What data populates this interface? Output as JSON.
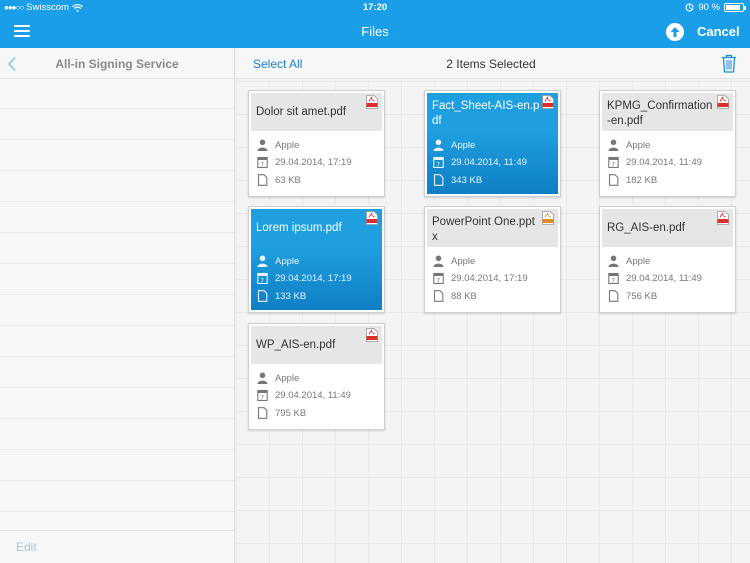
{
  "status_bar": {
    "carrier": "Swisscom",
    "time": "17:20",
    "battery": "90 %",
    "battery_level": 0.9
  },
  "nav_bar": {
    "title": "Files",
    "cancel_label": "Cancel",
    "upload_icon": "upload-arrow-icon",
    "menu_icon": "hamburger-menu-icon"
  },
  "sidebar": {
    "title": "All-in Signing Service",
    "edit_label": "Edit",
    "back_icon": "chevron-left-icon"
  },
  "toolbar": {
    "select_all_label": "Select All",
    "selected_count": "2 Items Selected",
    "trash_icon": "trash-icon"
  },
  "colors": {
    "accent": "#1a9ee8",
    "selected": "#1387cf",
    "pdf": "#d9302c",
    "pptx": "#e08a2a"
  },
  "files": [
    {
      "name": "Dolor sit amet.pdf",
      "type": "pdf",
      "owner": "Apple",
      "date": "29.04.2014, 17:19",
      "size": "63 KB",
      "selected": false
    },
    {
      "name": "Fact_Sheet-AIS-en.pdf",
      "type": "pdf",
      "owner": "Apple",
      "date": "29.04.2014, 11:49",
      "size": "343 KB",
      "selected": true
    },
    {
      "name": "KPMG_Confirmation-en.pdf",
      "type": "pdf",
      "owner": "Apple",
      "date": "29.04.2014, 11:49",
      "size": "182 KB",
      "selected": false
    },
    {
      "name": "Lorem ipsum.pdf",
      "type": "pdf",
      "owner": "Apple",
      "date": "29.04.2014, 17:19",
      "size": "133 KB",
      "selected": true
    },
    {
      "name": "PowerPoint One.pptx",
      "type": "pptx",
      "owner": "Apple",
      "date": "29.04.2014, 17:19",
      "size": "88 KB",
      "selected": false
    },
    {
      "name": "RG_AIS-en.pdf",
      "type": "pdf",
      "owner": "Apple",
      "date": "29.04.2014, 11:49",
      "size": "756 KB",
      "selected": false
    },
    {
      "name": "WP_AIS-en.pdf",
      "type": "pdf",
      "owner": "Apple",
      "date": "29.04.2014, 11:49",
      "size": "795 KB",
      "selected": false
    }
  ]
}
